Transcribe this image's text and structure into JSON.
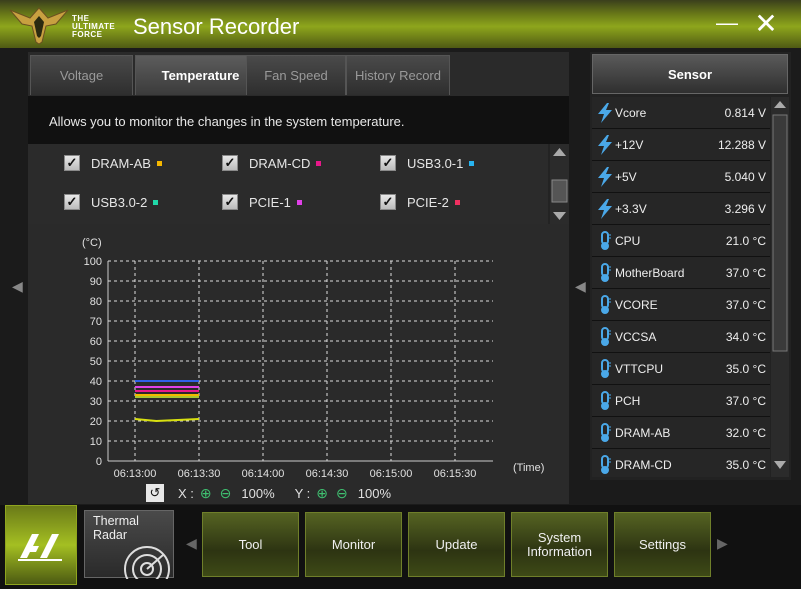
{
  "window": {
    "brand_lines": [
      "THE",
      "ULTIMATE",
      "FORCE"
    ],
    "title": "Sensor Recorder",
    "minimize_glyph": "—",
    "close_glyph": "✕"
  },
  "tabs": [
    {
      "label": "Voltage",
      "active": false
    },
    {
      "label": "Temperature",
      "active": true
    },
    {
      "label": "Fan Speed",
      "active": false
    },
    {
      "label": "History Record",
      "active": false
    }
  ],
  "description": "Allows you to monitor the changes in the system temperature.",
  "checkboxes": [
    {
      "label": "DRAM-AB",
      "checked": true,
      "color": "#f5b700"
    },
    {
      "label": "DRAM-CD",
      "checked": true,
      "color": "#e8188a"
    },
    {
      "label": "USB3.0-1",
      "checked": true,
      "color": "#28b4f0"
    },
    {
      "label": "USB3.0-2",
      "checked": true,
      "color": "#20d8a8"
    },
    {
      "label": "PCIE-1",
      "checked": true,
      "color": "#e040e8"
    },
    {
      "label": "PCIE-2",
      "checked": true,
      "color": "#f03060"
    }
  ],
  "chart_data": {
    "type": "line",
    "ylabel": "(°C)",
    "xlabel": "(Time)",
    "ylim": [
      0,
      100
    ],
    "y_ticks": [
      0,
      10,
      20,
      30,
      40,
      50,
      60,
      70,
      80,
      90,
      100
    ],
    "x_ticks": [
      "06:13:00",
      "06:13:30",
      "06:14:00",
      "06:14:30",
      "06:15:00",
      "06:15:30"
    ],
    "grid": true,
    "series": [
      {
        "color": "#3060e8",
        "x": [
          "06:13:00",
          "06:13:30"
        ],
        "values": [
          40,
          40
        ]
      },
      {
        "color": "#e040e8",
        "x": [
          "06:13:00",
          "06:13:30"
        ],
        "values": [
          37,
          37
        ]
      },
      {
        "color": "#e8188a",
        "x": [
          "06:13:00",
          "06:13:30"
        ],
        "values": [
          35,
          35
        ]
      },
      {
        "color": "#f5b700",
        "x": [
          "06:13:00",
          "06:13:30"
        ],
        "values": [
          33,
          33
        ]
      },
      {
        "color": "#a8c830",
        "x": [
          "06:13:00",
          "06:13:30"
        ],
        "values": [
          32,
          32
        ]
      },
      {
        "color": "#d8e010",
        "x": [
          "06:13:00",
          "06:13:10",
          "06:13:30"
        ],
        "values": [
          21,
          20,
          21
        ]
      }
    ]
  },
  "zoom": {
    "x_label": "X :",
    "x_value": "100%",
    "y_label": "Y :",
    "y_value": "100%"
  },
  "sensor": {
    "header": "Sensor",
    "rows": [
      {
        "icon": "lightning-icon",
        "name": "Vcore",
        "value": "0.814  V"
      },
      {
        "icon": "lightning-icon",
        "name": "+12V",
        "value": "12.288  V"
      },
      {
        "icon": "lightning-icon",
        "name": "+5V",
        "value": "5.040  V"
      },
      {
        "icon": "lightning-icon",
        "name": "+3.3V",
        "value": "3.296  V"
      },
      {
        "icon": "thermometer-icon",
        "name": "CPU",
        "value": "21.0 °C"
      },
      {
        "icon": "thermometer-icon",
        "name": "MotherBoard",
        "value": "37.0 °C"
      },
      {
        "icon": "thermometer-icon",
        "name": "VCORE",
        "value": "37.0 °C"
      },
      {
        "icon": "thermometer-icon",
        "name": "VCCSA",
        "value": "34.0 °C"
      },
      {
        "icon": "thermometer-icon",
        "name": "VTTCPU",
        "value": "35.0 °C"
      },
      {
        "icon": "thermometer-icon",
        "name": "PCH",
        "value": "37.0 °C"
      },
      {
        "icon": "thermometer-icon",
        "name": "DRAM-AB",
        "value": "32.0 °C"
      },
      {
        "icon": "thermometer-icon",
        "name": "DRAM-CD",
        "value": "35.0 °C"
      }
    ]
  },
  "bottom": {
    "thermal_radar": "Thermal Radar",
    "buttons": [
      "Tool",
      "Monitor",
      "Update",
      "System Information",
      "Settings"
    ]
  },
  "colors": {
    "accent": "#8ea61c"
  }
}
